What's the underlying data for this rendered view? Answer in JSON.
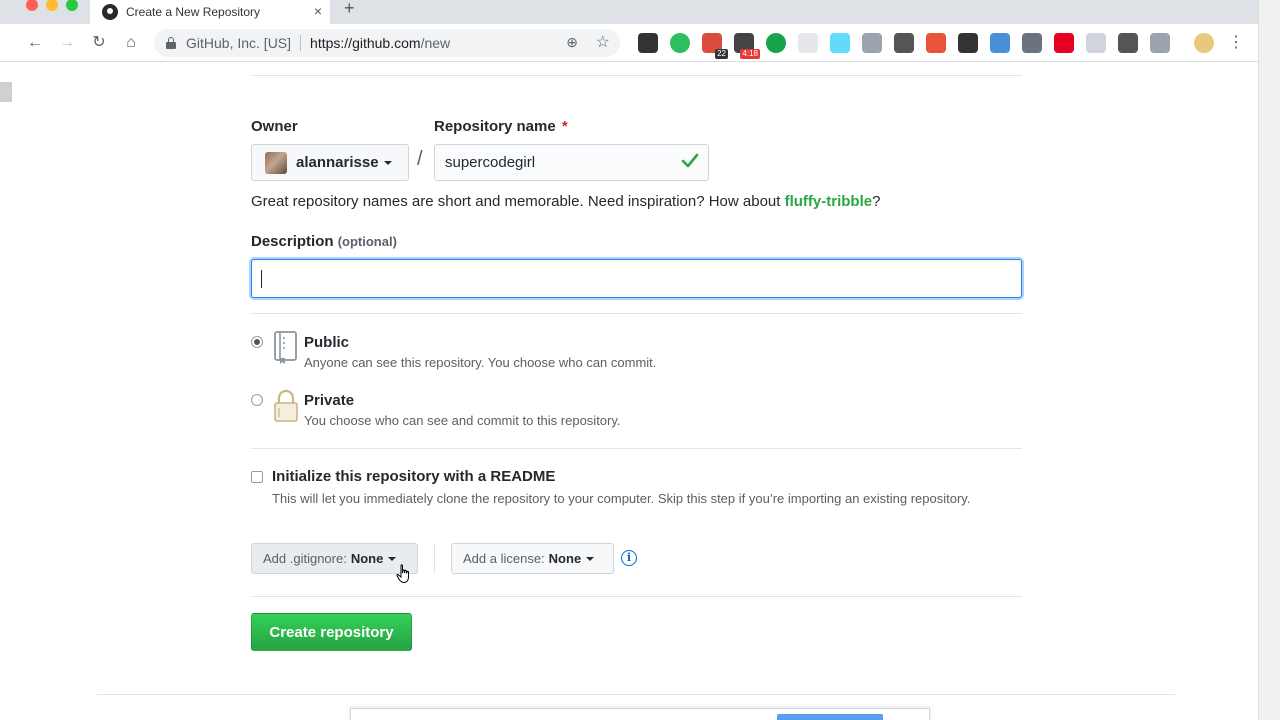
{
  "browser": {
    "tab_title": "Create a New Repository",
    "tab_close": "×",
    "new_tab": "+",
    "back": "←",
    "forward": "→",
    "reload": "↻",
    "home": "⌂",
    "site_identity": "GitHub, Inc. [US]",
    "url_host": "https://github.com",
    "url_path": "/new",
    "zoom_glyph": "⊕",
    "star_glyph": "☆",
    "menu_glyph": "⋮",
    "extensions": [
      {
        "name": "pen-extension-icon",
        "color": "#333333",
        "badge": ""
      },
      {
        "name": "evernote-extension-icon",
        "color": "#2dbe60",
        "badge": ""
      },
      {
        "name": "todoist-extension-icon",
        "color": "#db4c3f",
        "badge": "22"
      },
      {
        "name": "timer-extension-icon",
        "color": "#444444",
        "badge": "4:18"
      },
      {
        "name": "green-dot-extension-icon",
        "color": "#17a34a",
        "badge": ""
      },
      {
        "name": "grid-extension-icon",
        "color": "#e5e7eb",
        "badge": ""
      },
      {
        "name": "react-devtools-extension-icon",
        "color": "#61dafb",
        "badge": ""
      },
      {
        "name": "circle-extension-icon",
        "color": "#9ca3af",
        "badge": ""
      },
      {
        "name": "onepassword-extension-icon",
        "color": "#555555",
        "badge": ""
      },
      {
        "name": "e-extension-icon",
        "color": "#e8533a",
        "badge": ""
      },
      {
        "name": "typography-extension-icon",
        "color": "#333333",
        "badge": ""
      },
      {
        "name": "triangle-extension-icon",
        "color": "#4a90d9",
        "badge": ""
      },
      {
        "name": "v-extension-icon",
        "color": "#6b7280",
        "badge": ""
      },
      {
        "name": "pinterest-extension-icon",
        "color": "#e60023",
        "badge": ""
      },
      {
        "name": "ghost-extension-icon",
        "color": "#d1d5db",
        "badge": ""
      },
      {
        "name": "chain-extension-icon",
        "color": "#555555",
        "badge": ""
      },
      {
        "name": "b-extension-icon",
        "color": "#9ca3af",
        "badge": ""
      }
    ],
    "extension_badge_colors": {
      "todoist": "#333333",
      "timer": "#e53935"
    }
  },
  "form": {
    "owner_label": "Owner",
    "owner_value": "alannarisse",
    "repo_label": "Repository name",
    "required_marker": "*",
    "separator": "/",
    "repo_value": "supercodegirl",
    "hint_prefix": "Great repository names are short and memorable. Need inspiration? How about ",
    "hint_suggestion": "fluffy-tribble",
    "hint_suffix": "?",
    "description_label": "Description",
    "description_optional": "(optional)",
    "description_value": "",
    "visibility": [
      {
        "title": "Public",
        "note": "Anyone can see this repository. You choose who can commit.",
        "selected": true
      },
      {
        "title": "Private",
        "note": "You choose who can see and commit to this repository.",
        "selected": false
      }
    ],
    "readme_title": "Initialize this repository with a README",
    "readme_note": "This will let you immediately clone the repository to your computer. Skip this step if you’re importing an existing repository.",
    "readme_checked": false,
    "gitignore_label": "Add .gitignore:",
    "gitignore_value": "None",
    "license_label": "Add a license:",
    "license_value": "None",
    "info_glyph": "i",
    "submit_label": "Create repository"
  },
  "colors": {
    "accent_blue": "#0366d6",
    "success_green": "#28a745",
    "required_red": "#cb2431"
  }
}
